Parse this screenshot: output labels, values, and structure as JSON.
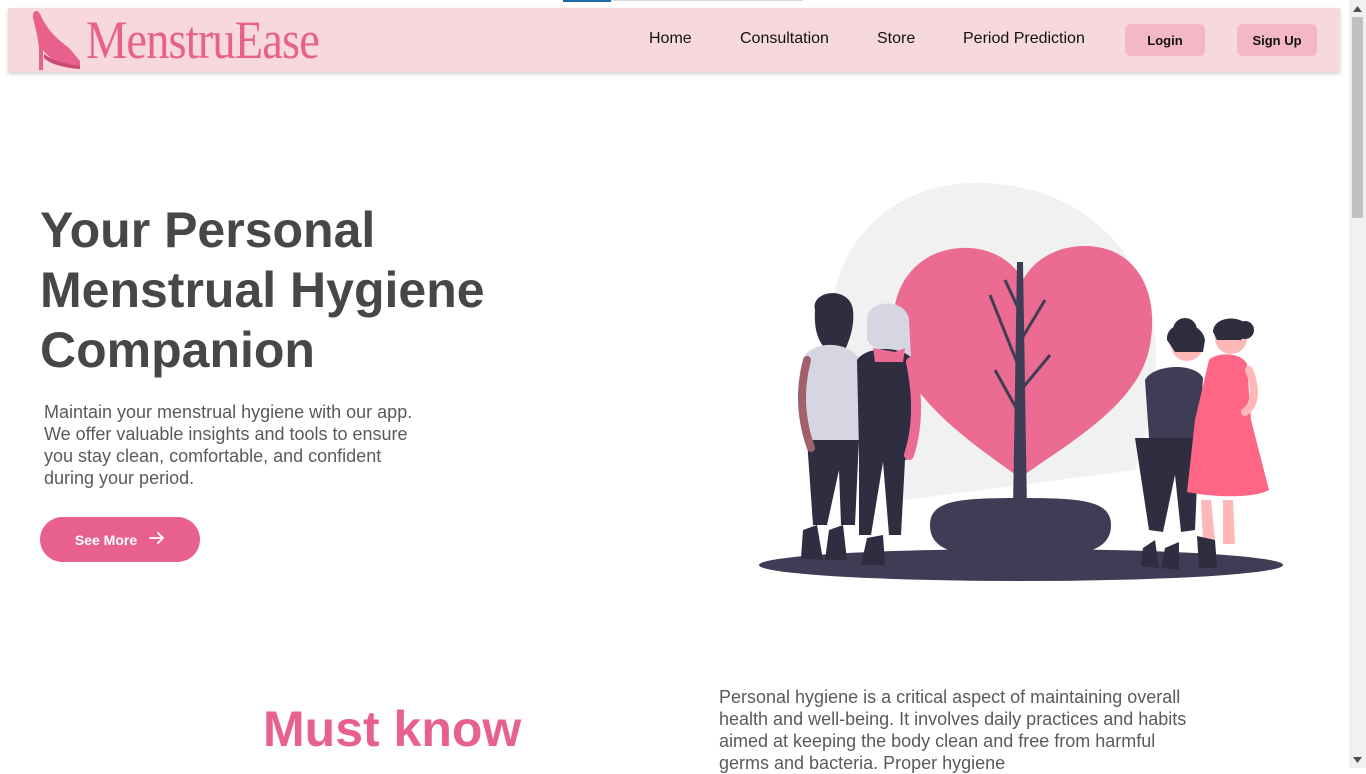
{
  "brand": {
    "name": "MenstruEase",
    "logo_icon": "high-heel-icon",
    "color": "#e8618c"
  },
  "nav": {
    "links": [
      "Home",
      "Consultation",
      "Store",
      "Period Prediction"
    ],
    "login_label": "Login",
    "signup_label": "Sign Up",
    "background": "#f7d9dd"
  },
  "hero": {
    "title": "Your Personal Menstrual Hygiene Companion",
    "description": "Maintain your menstrual hygiene with our app. We offer valuable insights and tools to ensure you stay clean, comfortable, and confident during your period.",
    "button_label": "See More",
    "button_icon": "arrow-right-icon",
    "illustration": "women-with-heart-tree-illustration"
  },
  "must_know": {
    "heading": "Must know",
    "paragraph": "Personal hygiene is a critical aspect of maintaining overall health and well-being. It involves daily practices and habits aimed at keeping the body clean and free from harmful germs and bacteria. Proper hygiene"
  },
  "colors": {
    "accent": "#e8618c",
    "button_soft": "#f3b7c6",
    "text_dark": "#474747"
  }
}
